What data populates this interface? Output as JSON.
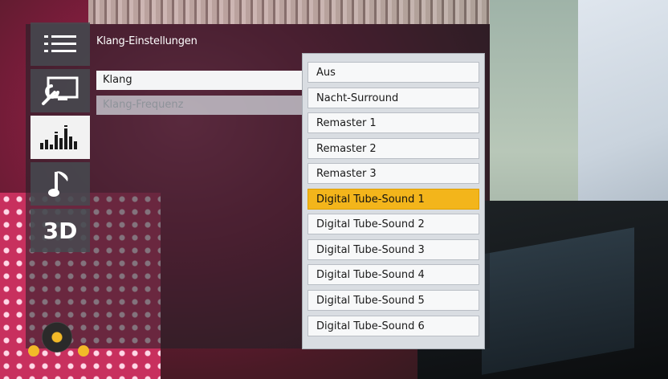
{
  "header": {
    "title": "Klang-Einstellungen"
  },
  "sidebar": {
    "icons": [
      {
        "name": "menu-list-icon"
      },
      {
        "name": "picture-settings-icon"
      },
      {
        "name": "equalizer-icon"
      },
      {
        "name": "music-note-icon"
      },
      {
        "name": "3d-icon",
        "label": "3D"
      }
    ]
  },
  "fields": {
    "klang": "Klang",
    "klang_frequenz": "Klang-Frequenz"
  },
  "dropdown": {
    "selected_index": 5,
    "options": [
      "Aus",
      "Nacht-Surround",
      "Remaster 1",
      "Remaster 2",
      "Remaster 3",
      "Digital Tube-Sound 1",
      "Digital Tube-Sound 2",
      "Digital Tube-Sound 3",
      "Digital Tube-Sound 4",
      "Digital Tube-Sound 5",
      "Digital Tube-Sound 6"
    ]
  },
  "colors": {
    "selection": "#f3b51b",
    "nav_dots": "#f2b928"
  }
}
